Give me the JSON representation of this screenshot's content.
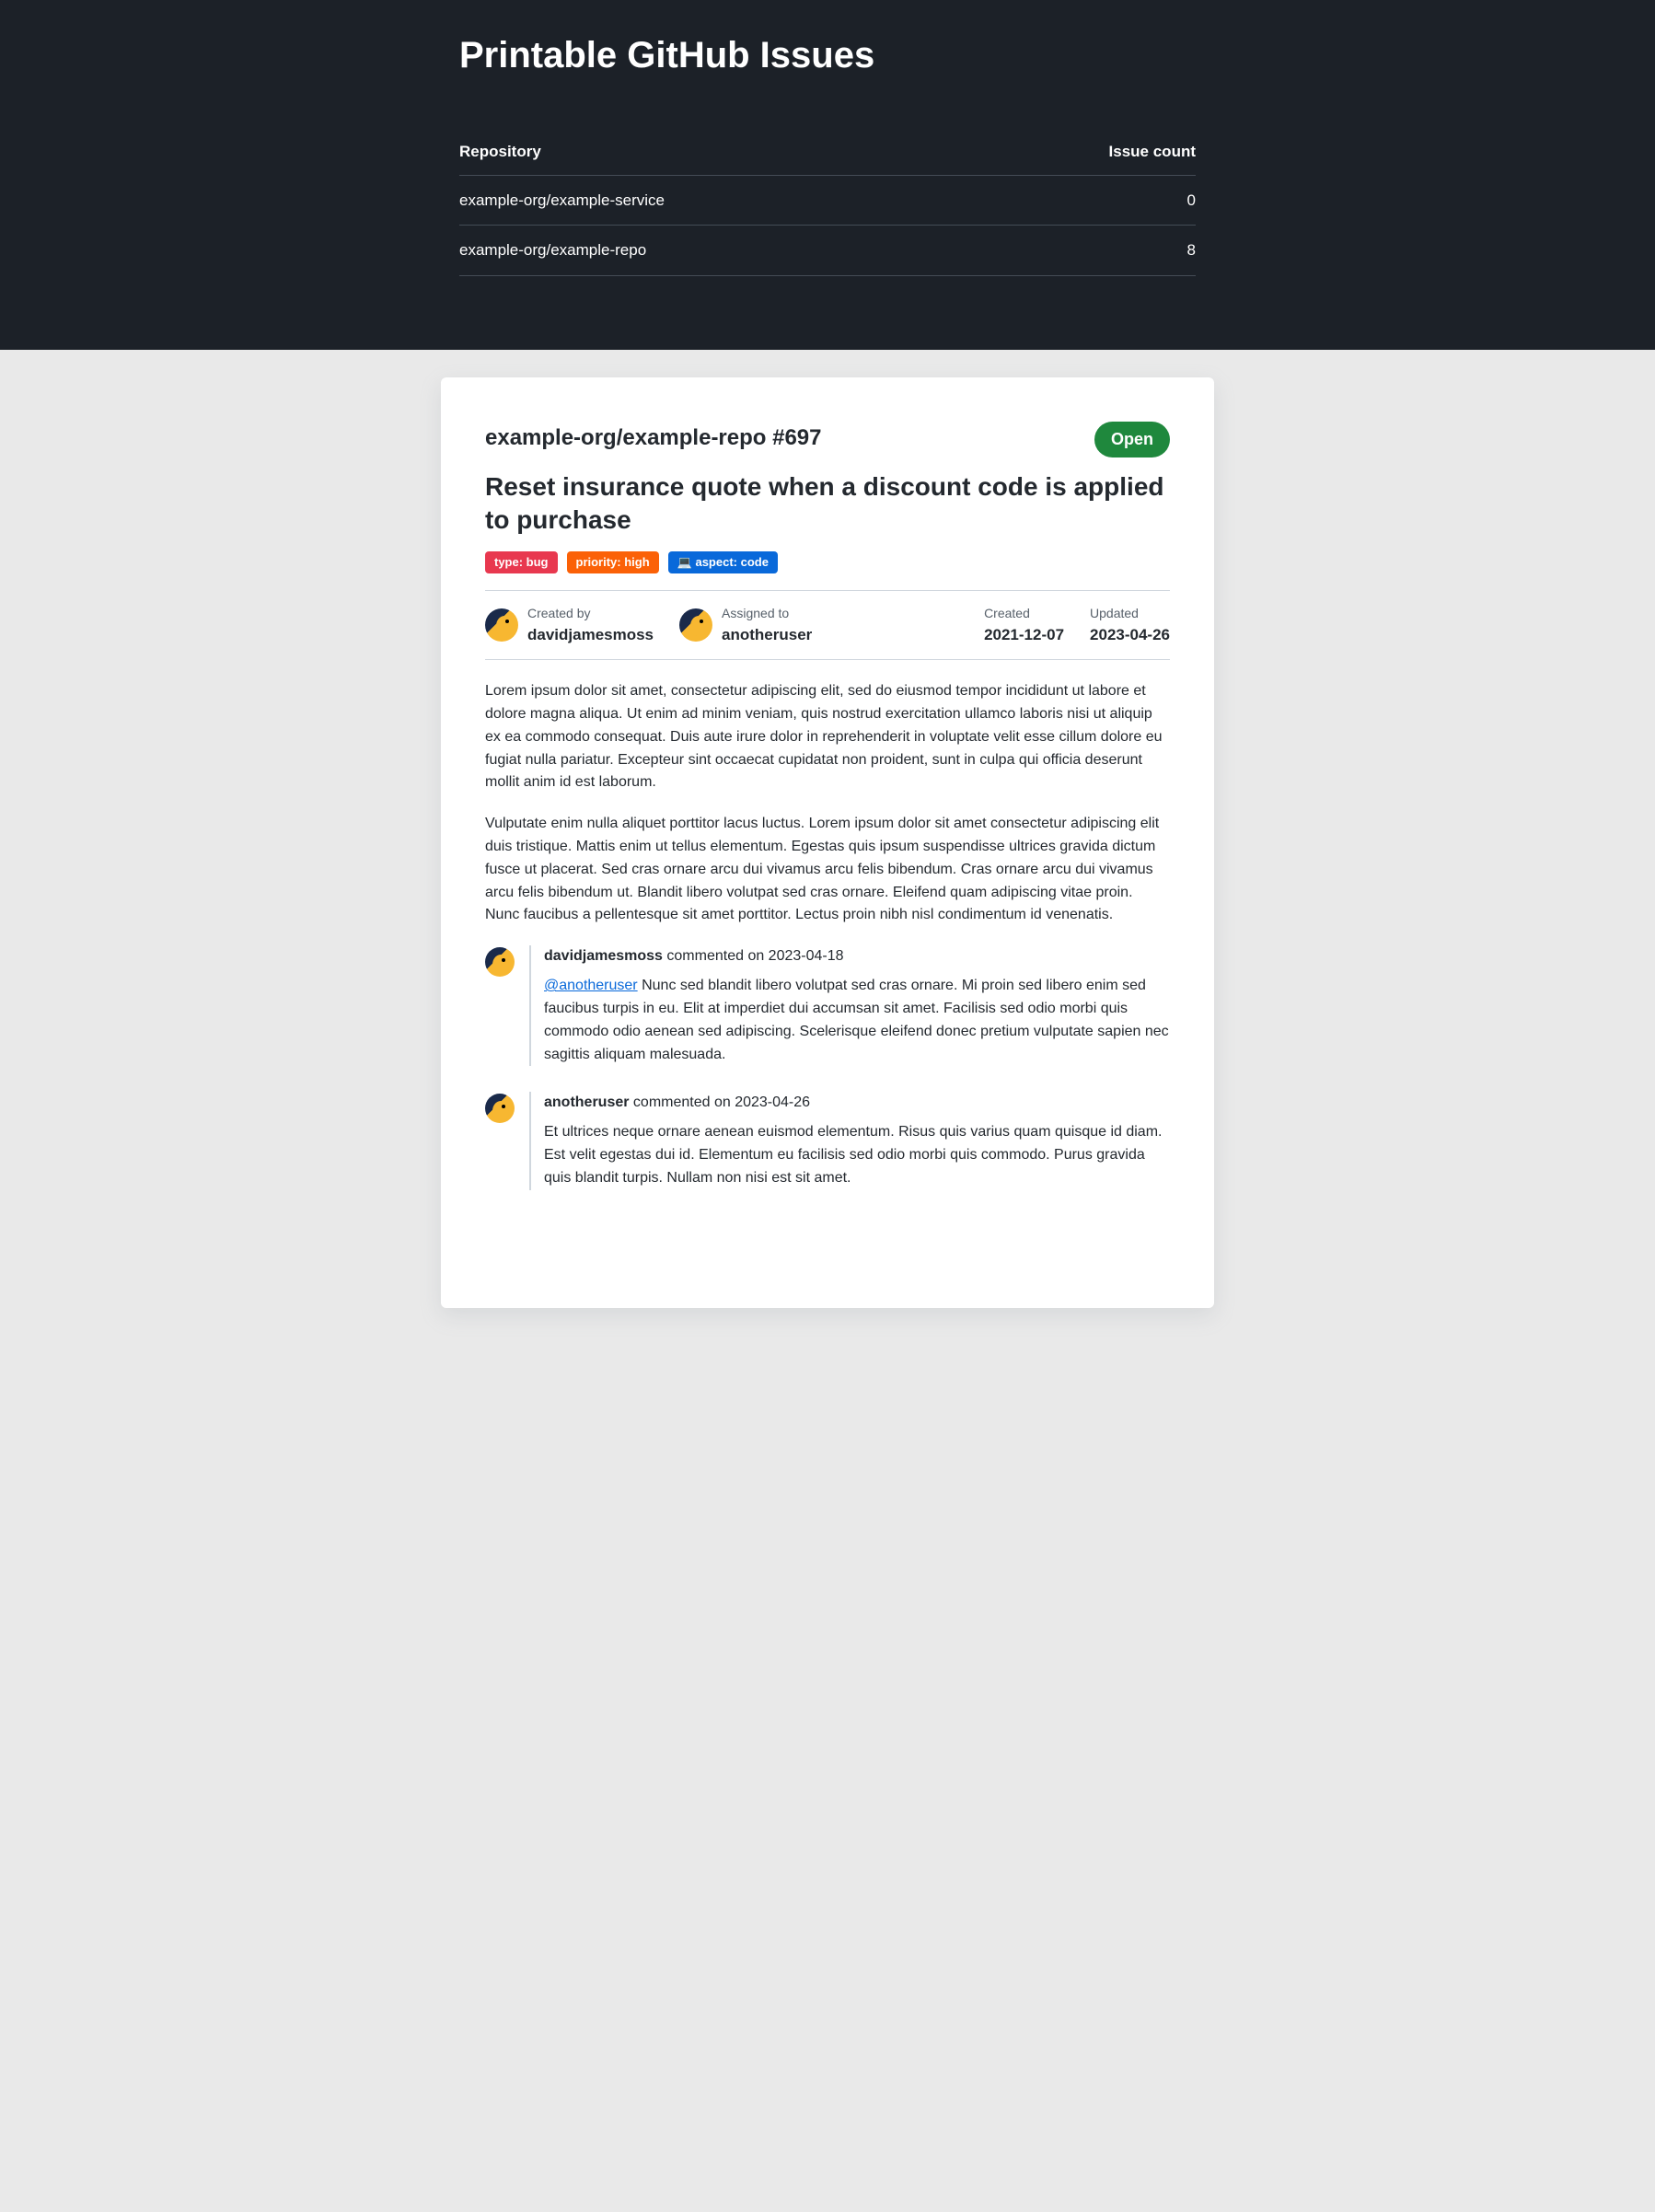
{
  "page": {
    "title": "Printable GitHub Issues"
  },
  "repo_table": {
    "headers": {
      "repo": "Repository",
      "count": "Issue count"
    },
    "rows": [
      {
        "repo": "example-org/example-service",
        "count": "0"
      },
      {
        "repo": "example-org/example-repo",
        "count": "8"
      }
    ]
  },
  "issue": {
    "ref": "example-org/example-repo #697",
    "status": "Open",
    "title": "Reset insurance quote when a discount code is applied to purchase",
    "labels": [
      {
        "text": "type: bug",
        "bg": "#e8384f"
      },
      {
        "text": "priority: high",
        "bg": "#fb6107"
      },
      {
        "text": "💻 aspect: code",
        "bg": "#0969da"
      }
    ],
    "meta": {
      "created_by": {
        "label": "Created by",
        "value": "davidjamesmoss"
      },
      "assigned_to": {
        "label": "Assigned to",
        "value": "anotheruser"
      },
      "created": {
        "label": "Created",
        "value": "2021-12-07"
      },
      "updated": {
        "label": "Updated",
        "value": "2023-04-26"
      }
    },
    "body": [
      "Lorem ipsum dolor sit amet, consectetur adipiscing elit, sed do eiusmod tempor incididunt ut labore et dolore magna aliqua. Ut enim ad minim veniam, quis nostrud exercitation ullamco laboris nisi ut aliquip ex ea commodo consequat. Duis aute irure dolor in reprehenderit in voluptate velit esse cillum dolore eu fugiat nulla pariatur. Excepteur sint occaecat cupidatat non proident, sunt in culpa qui officia deserunt mollit anim id est laborum.",
      "Vulputate enim nulla aliquet porttitor lacus luctus. Lorem ipsum dolor sit amet consectetur adipiscing elit duis tristique. Mattis enim ut tellus elementum. Egestas quis ipsum suspendisse ultrices gravida dictum fusce ut placerat. Sed cras ornare arcu dui vivamus arcu felis bibendum. Cras ornare arcu dui vivamus arcu felis bibendum ut. Blandit libero volutpat sed cras ornare. Eleifend quam adipiscing vitae proin. Nunc faucibus a pellentesque sit amet porttitor. Lectus proin nibh nisl condimentum id venenatis."
    ],
    "comments": [
      {
        "author": "davidjamesmoss",
        "on": " commented on 2023-04-18",
        "mention": "@anotheruser",
        "body": " Nunc sed blandit libero volutpat sed cras ornare. Mi proin sed libero enim sed faucibus turpis in eu. Elit at imperdiet dui accumsan sit amet. Facilisis sed odio morbi quis commodo odio aenean sed adipiscing. Scelerisque eleifend donec pretium vulputate sapien nec sagittis aliquam malesuada."
      },
      {
        "author": "anotheruser",
        "on": " commented on 2023-04-26",
        "mention": "",
        "body": "Et ultrices neque ornare aenean euismod elementum. Risus quis varius quam quisque id diam. Est velit egestas dui id. Elementum eu facilisis sed odio morbi quis commodo. Purus gravida quis blandit turpis. Nullam non nisi est sit amet."
      }
    ]
  }
}
